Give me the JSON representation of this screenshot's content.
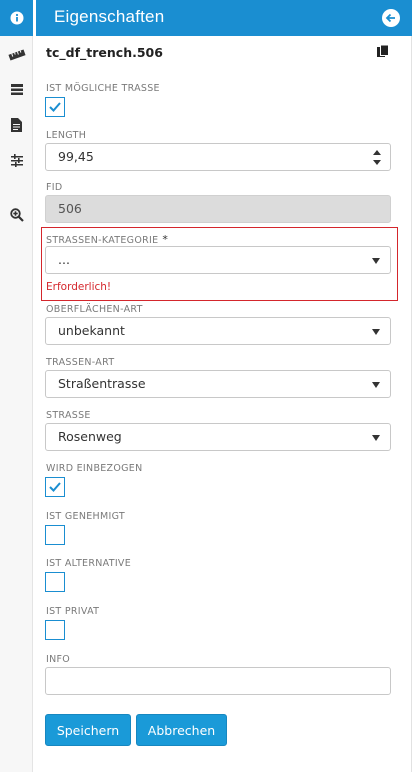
{
  "header": {
    "title": "Eigenschaften"
  },
  "sidebar": {
    "icons": [
      "info-icon",
      "ruler-icon",
      "layers-icon",
      "document-icon",
      "tune-icon",
      "zoom-icon"
    ]
  },
  "feature": {
    "name": "tc_df_trench.506"
  },
  "fields": {
    "ist_moegliche_trasse": {
      "label": "IST MÖGLICHE TRASSE",
      "checked": true
    },
    "length": {
      "label": "LENGTH",
      "value": "99,45"
    },
    "fid": {
      "label": "FID",
      "value": "506"
    },
    "strassen_kategorie": {
      "label": "STRASSEN-KATEGORIE",
      "required_mark": "*",
      "value": "...",
      "error": "Erforderlich!"
    },
    "oberflaechen_art": {
      "label": "OBERFLÄCHEN-ART",
      "value": "unbekannt"
    },
    "trassen_art": {
      "label": "TRASSEN-ART",
      "value": "Straßentrasse"
    },
    "strasse": {
      "label": "STRASSE",
      "value": "Rosenweg"
    },
    "wird_einbezogen": {
      "label": "WIRD EINBEZOGEN",
      "checked": true
    },
    "ist_genehmigt": {
      "label": "IST GENEHMIGT",
      "checked": false
    },
    "ist_alternative": {
      "label": "IST ALTERNATIVE",
      "checked": false
    },
    "ist_privat": {
      "label": "IST PRIVAT",
      "checked": false
    },
    "info": {
      "label": "INFO",
      "value": ""
    }
  },
  "actions": {
    "save_label": "Speichern",
    "cancel_label": "Abbrechen"
  },
  "colors": {
    "accent": "#1a8ed1",
    "error": "#d4262c",
    "readonly_bg": "#dcdcdc"
  }
}
